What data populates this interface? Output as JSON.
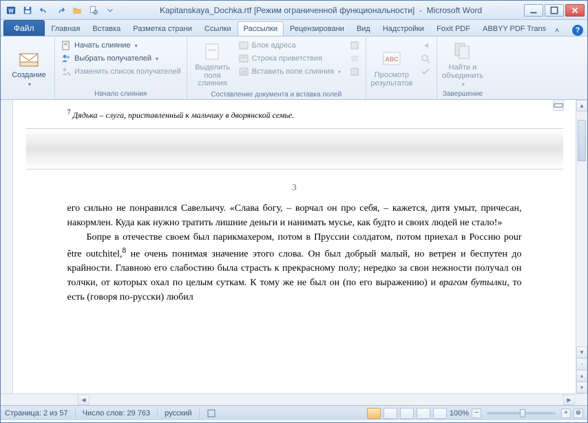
{
  "title": {
    "filename": "Kapitanskaya_Dochka.rtf",
    "mode": "[Режим ограниченной функциональности]",
    "app": "Microsoft Word"
  },
  "tabs": {
    "file": "Файл",
    "items": [
      "Главная",
      "Вставка",
      "Разметка страни",
      "Ссылки",
      "Рассылки",
      "Рецензировани",
      "Вид",
      "Надстройки",
      "Foxit PDF",
      "ABBYY PDF Trans"
    ],
    "active_index": 4
  },
  "ribbon": {
    "create": {
      "label": "Создание",
      "group": ""
    },
    "start_merge": {
      "start": "Начать слияние",
      "select": "Выбрать получателей",
      "edit": "Изменить список получателей",
      "group": "Начало слияния"
    },
    "fields": {
      "highlight": "Выделить поля слияния",
      "address": "Блок адреса",
      "greeting": "Строка приветствия",
      "insert": "Вставить поле слияния",
      "group": "Составление документа и вставка полей"
    },
    "preview": {
      "label": "Просмотр результатов",
      "group": ""
    },
    "finish": {
      "label": "Найти и объединить",
      "group": "Завершение"
    }
  },
  "document": {
    "footnote_num": "7",
    "footnote_text": "Дядька – слуга, приставленный к мальчику в дворянской семье.",
    "page_number": "3",
    "para1": "его сильно не понравился Савельичу. «Слава богу, – ворчал он про себя, – кажется, дитя умыт, причесан, накормлен. Куда как нужно тратить лишние деньги и нанимать мусье, как будто и своих людей не стало!»",
    "para2_a": "Бопре в отечестве своем был парикмахером, потом в Пруссии солдатом, потом приехал в Россию pour être outchitel,",
    "para2_sup": "8",
    "para2_b": " не очень понимая значение этого слова. Он был добрый малый, но ветрен и беспутен до крайности. Главною его слабостию была страсть к прекрасному полу; нередко за свои нежности получал он толчки, от которых охал по целым суткам. К тому же не был он (по его выражению) и ",
    "para2_c": "врагом бутылки",
    "para2_d": ", то есть (говоря по-русски) любил"
  },
  "status": {
    "page": "Страница: 2 из 57",
    "words": "Число слов: 29 763",
    "lang": "русский",
    "zoom": "100%"
  }
}
